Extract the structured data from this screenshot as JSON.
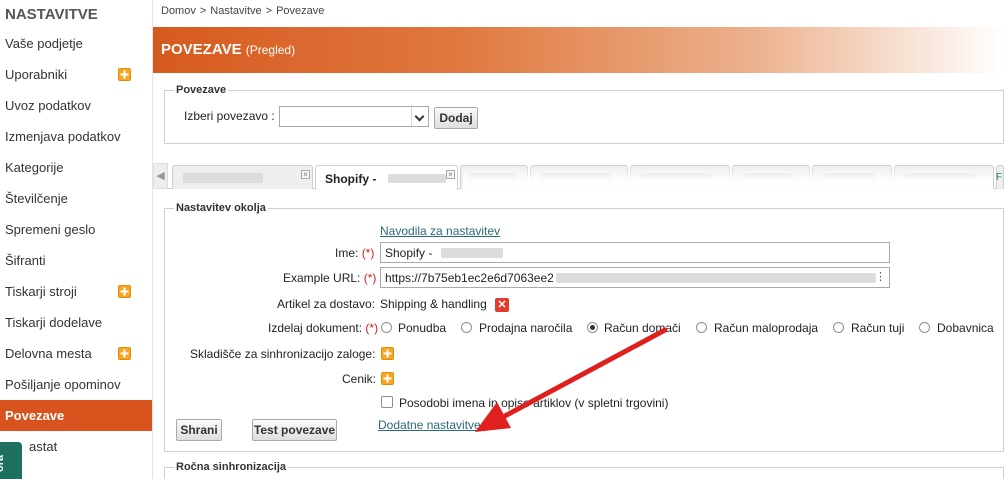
{
  "sidebar": {
    "title": "NASTAVITVE",
    "items": [
      {
        "label": "Vaše podjetje"
      },
      {
        "label": "Uporabniki"
      },
      {
        "label": "Uvoz podatkov"
      },
      {
        "label": "Izmenjava podatkov"
      },
      {
        "label": "Kategorije"
      },
      {
        "label": "Številčenje"
      },
      {
        "label": "Spremeni geslo"
      },
      {
        "label": "Šifranti"
      },
      {
        "label": "Tiskarji stroji"
      },
      {
        "label": "Tiskarji dodelave"
      },
      {
        "label": "Delovna mesta"
      },
      {
        "label": "Pošiljanje opominov"
      },
      {
        "label": "Povezave"
      },
      {
        "label": "astat"
      }
    ],
    "badge": "ora"
  },
  "breadcrumb": [
    "Domov",
    ">",
    "Nastavitve",
    ">",
    "Povezave"
  ],
  "banner": {
    "title": "POVEZAVE",
    "subtitle": "(Pregled)"
  },
  "connections_box": {
    "legend": "Povezave",
    "select_label": "Izberi povezavo :",
    "add_button": "Dodaj"
  },
  "tabs": {
    "active_label": "Shopify -",
    "cut_label": "F"
  },
  "settings": {
    "legend": "Nastavitev okolja",
    "instructions_link": "Navodila za nastavitev",
    "name_label": "Ime:",
    "name_value": "Shopify -",
    "url_label": "Example URL:",
    "url_value": "https://7b75eb1ec2e6d7063ee2",
    "delivery_label": "Artikel za dostavo:",
    "delivery_value": "Shipping & handling",
    "doc_label": "Izdelaj dokument:",
    "required_mark": "(*)",
    "doc_options": [
      "Ponudba",
      "Prodajna naročila",
      "Račun domači",
      "Račun maloprodaja",
      "Račun tuji",
      "Dobavnica"
    ],
    "doc_selected": "Račun domači",
    "warehouse_label": "Skladišče za sinhronizacijo zaloge:",
    "pricelist_label": "Cenik:",
    "update_names_label": "Posodobi imena in opise artiklov (v spletni trgovini)",
    "save_button": "Shrani",
    "test_button": "Test povezave",
    "extra_link": "Dodatne nastavitve"
  },
  "manual_sync": {
    "legend": "Ročna sinhronizacija"
  },
  "colors": {
    "accent": "#d9531e",
    "link": "#2a6b7a",
    "arrow": "#e0201f"
  },
  "icons": {
    "plus": "plus-icon",
    "remove": "x-icon"
  }
}
